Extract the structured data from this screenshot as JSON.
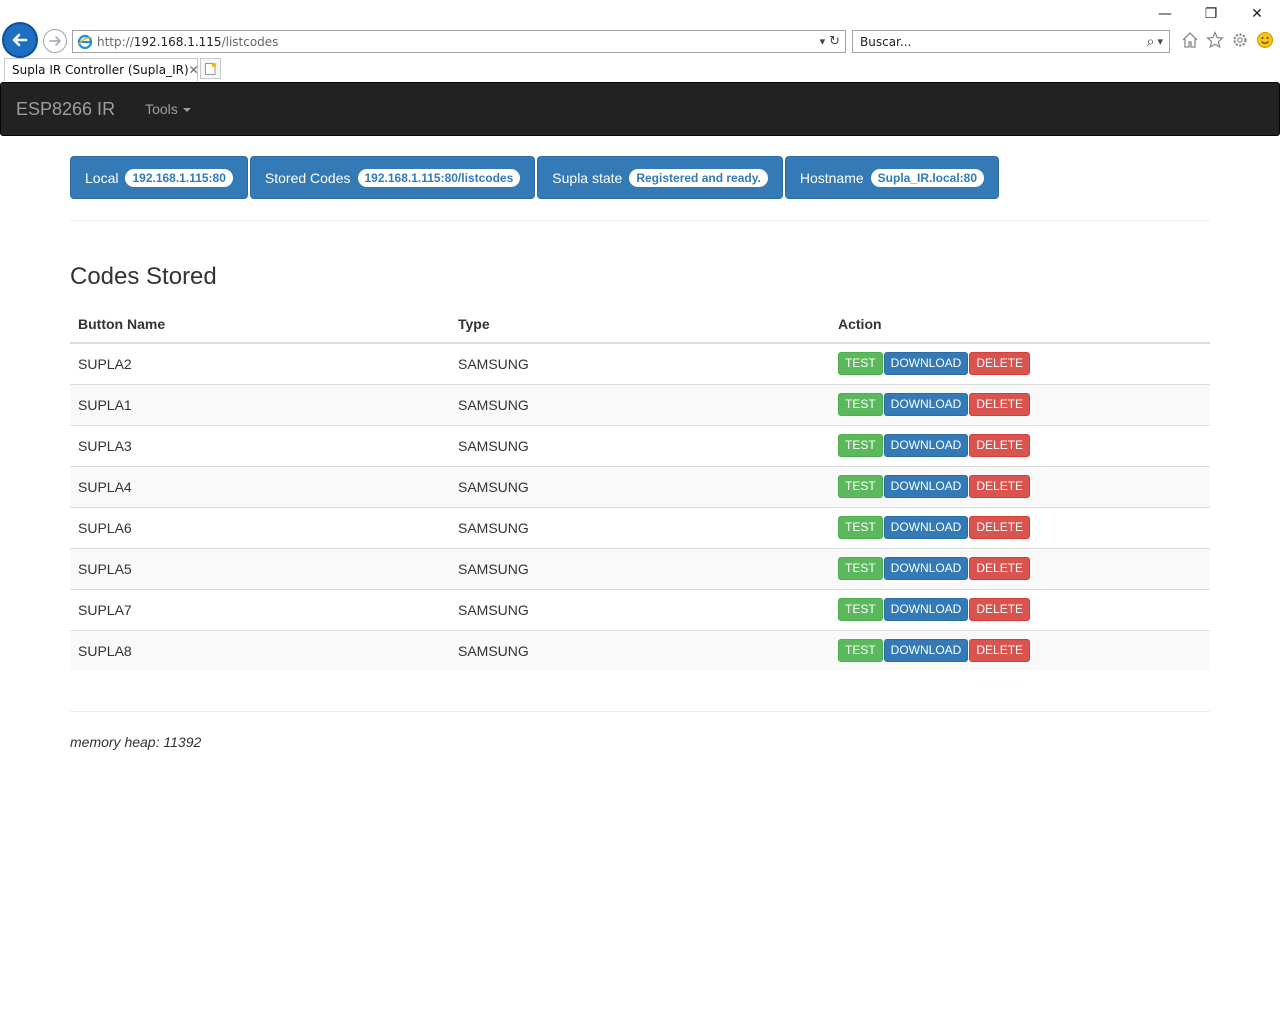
{
  "browser": {
    "url_prefix": "http://",
    "url_host": "192.168.1.115",
    "url_path": "/listcodes",
    "search_placeholder": "Buscar...",
    "tab_title": "Supla IR Controller (Supla_IR)",
    "minimize": "—",
    "restore": "❐",
    "close": "✕",
    "tab_close": "✕",
    "dropdown": "▾",
    "refresh": "↻",
    "search_glyph": "⌕"
  },
  "navbar": {
    "brand": "ESP8266 IR",
    "tools_label": "Tools"
  },
  "status": [
    {
      "label": "Local",
      "value": "192.168.1.115:80"
    },
    {
      "label": "Stored Codes",
      "value": "192.168.1.115:80/listcodes"
    },
    {
      "label": "Supla state",
      "value": "Registered and ready."
    },
    {
      "label": "Hostname",
      "value": "Supla_IR.local:80"
    }
  ],
  "codes": {
    "title": "Codes Stored",
    "headers": {
      "name": "Button Name",
      "type": "Type",
      "action": "Action"
    },
    "actions": {
      "test": "TEST",
      "download": "DOWNLOAD",
      "delete": "DELETE"
    },
    "rows": [
      {
        "name": "SUPLA2",
        "type": "SAMSUNG"
      },
      {
        "name": "SUPLA1",
        "type": "SAMSUNG"
      },
      {
        "name": "SUPLA3",
        "type": "SAMSUNG"
      },
      {
        "name": "SUPLA4",
        "type": "SAMSUNG"
      },
      {
        "name": "SUPLA6",
        "type": "SAMSUNG"
      },
      {
        "name": "SUPLA5",
        "type": "SAMSUNG"
      },
      {
        "name": "SUPLA7",
        "type": "SAMSUNG"
      },
      {
        "name": "SUPLA8",
        "type": "SAMSUNG"
      }
    ]
  },
  "footer": {
    "memory": "memory heap: 11392"
  },
  "colors": {
    "primary": "#337ab7",
    "success": "#5cb85c",
    "danger": "#d9534f",
    "navbar": "#222222"
  }
}
